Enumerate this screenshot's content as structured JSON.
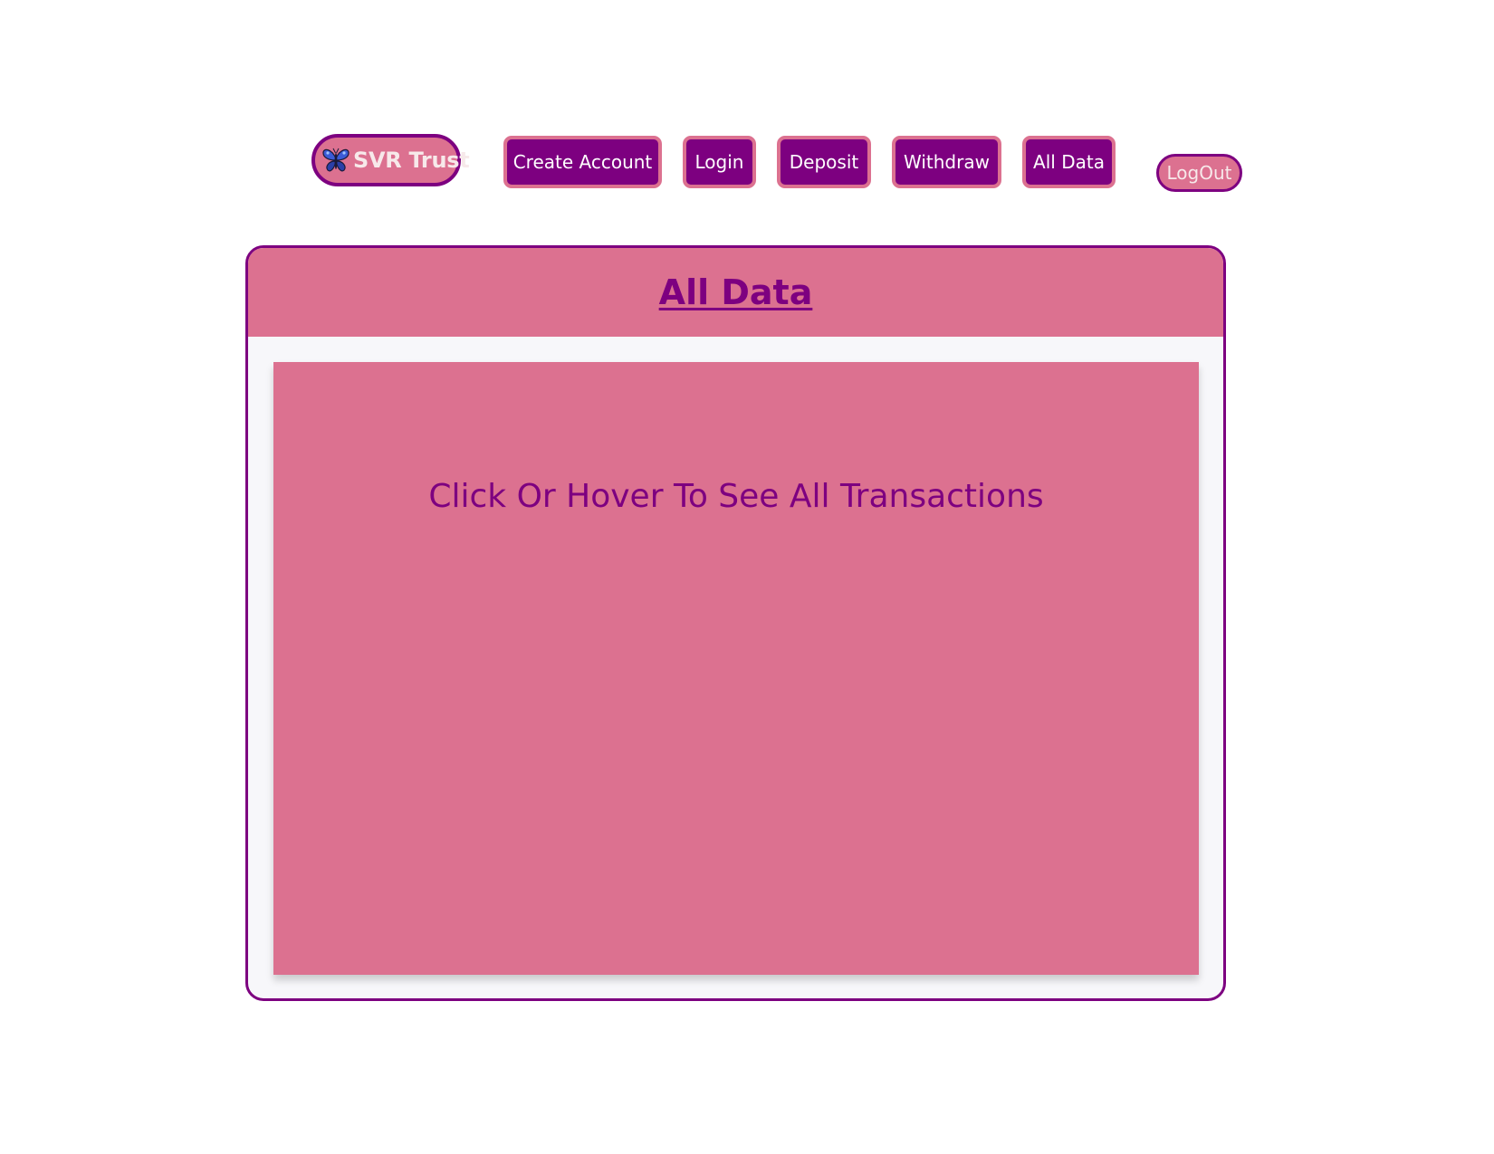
{
  "navbar": {
    "brand_label": "SVR Trust",
    "brand_icon": "butterfly-icon",
    "items": [
      {
        "label": "Create Account"
      },
      {
        "label": "Login"
      },
      {
        "label": "Deposit"
      },
      {
        "label": "Withdraw"
      },
      {
        "label": "All Data"
      }
    ],
    "logout_label": "LogOut"
  },
  "card": {
    "title": "All Data",
    "panel_text": "Click Or Hover To See All Transactions"
  },
  "colors": {
    "primary_purple": "#7d0080",
    "accent_pink": "#dc7190",
    "light_text": "#f7e9ea",
    "card_body": "#f7f7fa"
  }
}
